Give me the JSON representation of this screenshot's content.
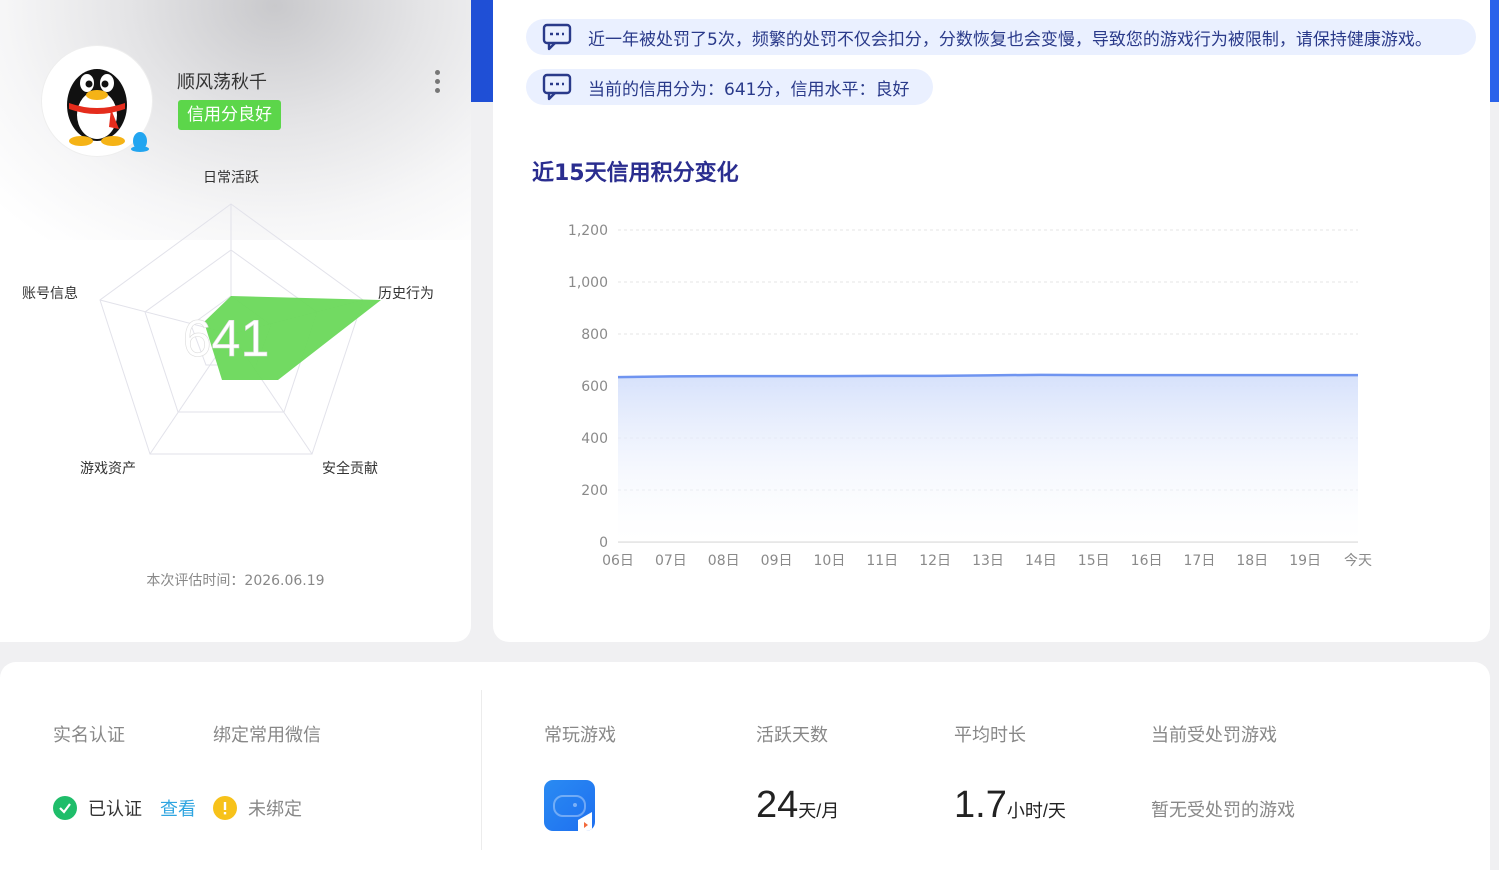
{
  "profile": {
    "nickname": "顺风荡秋千",
    "credit_badge": "信用分良好",
    "score": "641",
    "eval_time_label": "本次评估时间：2026.06.19",
    "radar_labels": {
      "top": "日常活跃",
      "right": "历史行为",
      "bottom_right": "安全贡献",
      "bottom_left": "游戏资产",
      "left": "账号信息"
    }
  },
  "notices": [
    "近一年被处罚了5次，频繁的处罚不仅会扣分，分数恢复也会变慢，导致您的游戏行为被限制，请保持健康游戏。",
    "当前的信用分为：641分，信用水平：良好"
  ],
  "chart_title": "近15天信用积分变化",
  "chart_data": {
    "type": "area",
    "title": "近15天信用积分变化",
    "xlabel": "",
    "ylabel": "",
    "categories": [
      "06日",
      "07日",
      "08日",
      "09日",
      "10日",
      "11日",
      "12日",
      "13日",
      "14日",
      "15日",
      "16日",
      "17日",
      "18日",
      "19日",
      "今天"
    ],
    "y_ticks": [
      "0",
      "200",
      "400",
      "600",
      "800",
      "1,000",
      "1,200"
    ],
    "ylim": [
      0,
      1200
    ],
    "values": [
      634,
      637,
      638,
      638,
      638,
      639,
      639,
      641,
      643,
      642,
      642,
      642,
      642,
      642,
      642
    ],
    "grid": true,
    "color": "#6f94f0"
  },
  "bottom": {
    "realname_head": "实名认证",
    "wechat_head": "绑定常用微信",
    "realname_status": "已认证",
    "realname_link": "查看",
    "wechat_status": "未绑定",
    "games_head": "常玩游戏",
    "active_days_head": "活跃天数",
    "avg_time_head": "平均时长",
    "penalty_head": "当前受处罚游戏",
    "active_days_value": "24",
    "active_days_unit": "天/月",
    "avg_time_value": "1.7",
    "avg_time_unit": "小时/天",
    "penalty_value": "暂无受处罚的游戏"
  },
  "colors": {
    "accent_blue": "#2a5be4",
    "badge_green": "#5cd64a",
    "radar_green": "#6ad85a",
    "ok_green": "#1fbd6a",
    "warn_yellow": "#f7c21a",
    "link_blue": "#2fa5e0"
  }
}
